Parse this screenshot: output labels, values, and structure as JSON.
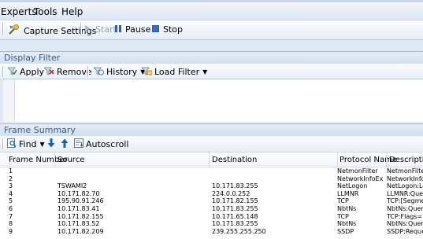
{
  "menu": {
    "items": [
      "Experts",
      "Tools",
      "Help"
    ]
  },
  "toolbar": {
    "capture_settings": "Capture Settings",
    "start": "Start",
    "pause": "Pause",
    "stop": "Stop"
  },
  "display_filter": {
    "title": "Display Filter",
    "apply": "Apply",
    "remove": "Remove",
    "history": "History",
    "load_filter": "Load Filter",
    "filter_text": ""
  },
  "frame_summary": {
    "title": "Frame Summary",
    "find": "Find",
    "autoscroll": "Autoscroll",
    "columns": [
      "Frame Number",
      "Source",
      "Destination",
      "Protocol Name",
      "Description"
    ],
    "rows": [
      [
        "1",
        "",
        "",
        "NetmonFilter",
        "NetmonFilter"
      ],
      [
        "2",
        "",
        "",
        "NetworkInfoEx",
        "NetworkInfoEx"
      ],
      [
        "3",
        "TSWAMI2",
        "10.171.83.255",
        "NetLogon",
        "NetLogon:Lo"
      ],
      [
        "4",
        "10.171.82.70",
        "224.0.0.252",
        "LLMNR",
        "LLMNR:Quer"
      ],
      [
        "5",
        "195.90.91.246",
        "10.171.82.155",
        "TCP",
        "TCP:[Segmen"
      ],
      [
        "6",
        "10.171.83.41",
        "10.171.83.255",
        "NbtNs",
        "NbtNs:Query"
      ],
      [
        "7",
        "10.171.82.155",
        "10.171.65.148",
        "TCP",
        "TCP:Flags=.."
      ],
      [
        "8",
        "10.171.83.52",
        "10.171.83.255",
        "NbtNs",
        "NbtNs:Query"
      ],
      [
        "9",
        "10.171.82.209",
        "239.255.255.250",
        "SSDP",
        "SSDP:Reque"
      ]
    ]
  },
  "colors": {
    "accent": "#1a5fb4",
    "header_text": "#3e5a82",
    "disabled_text": "#9aa4b1"
  }
}
